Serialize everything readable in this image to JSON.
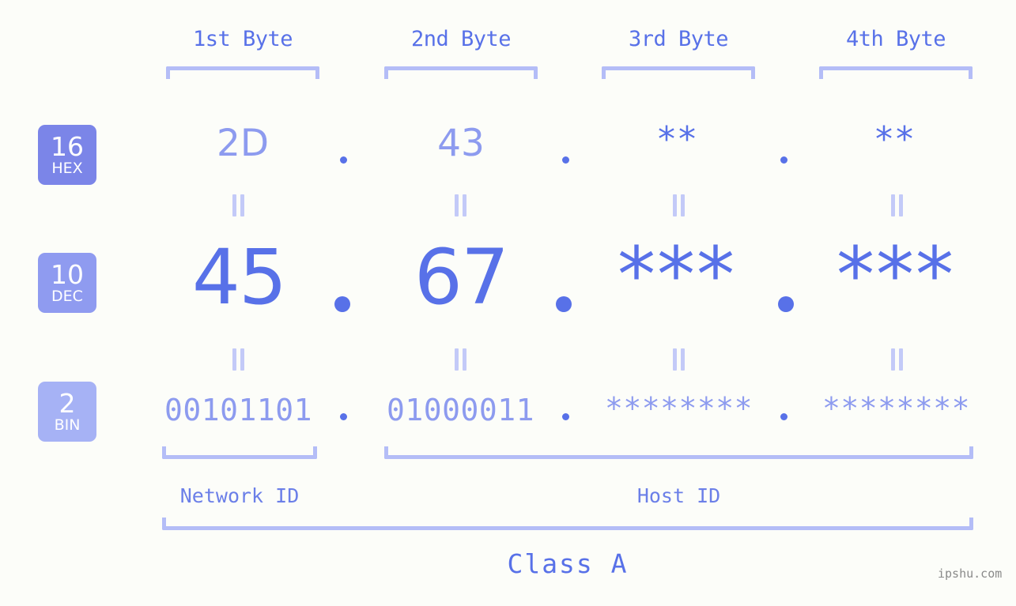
{
  "diagram": {
    "title": "IP address byte breakdown",
    "background_color": "#fcfdf9",
    "accent_color": "#5871e8",
    "accent_light_color": "#8d9bef",
    "bracket_color": "#b4bdf7"
  },
  "byte_headers": [
    {
      "label": "1st Byte"
    },
    {
      "label": "2nd Byte"
    },
    {
      "label": "3rd Byte"
    },
    {
      "label": "4th Byte"
    }
  ],
  "rows": [
    {
      "radix_number": "16",
      "radix_name": "HEX",
      "badge_color": "#7b85e8",
      "values": [
        "2D",
        "43",
        "**",
        "**"
      ],
      "separator": "."
    },
    {
      "radix_number": "10",
      "radix_name": "DEC",
      "badge_color": "#8f9bf0",
      "values": [
        "45",
        "67",
        "***",
        "***"
      ],
      "separator": "."
    },
    {
      "radix_number": "2",
      "radix_name": "BIN",
      "badge_color": "#a6b2f5",
      "values": [
        "00101101",
        "01000011",
        "********",
        "********"
      ],
      "separator": "."
    }
  ],
  "equality_marks": {
    "symbol": "=",
    "color": "#c3caf8",
    "count_per_gap": 4
  },
  "regions": [
    {
      "label": "Network ID"
    },
    {
      "label": "Host ID"
    }
  ],
  "class": {
    "label": "Class A"
  },
  "watermark": {
    "text": "ipshu.com"
  }
}
